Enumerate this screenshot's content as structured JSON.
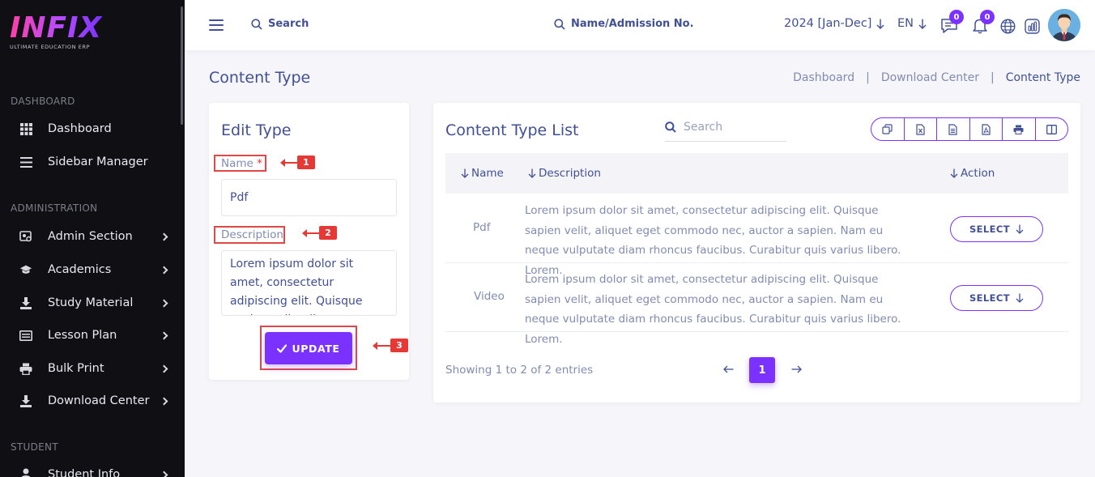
{
  "sidebar": {
    "logo": {
      "text": "INFIX",
      "subtitle": "ULTIMATE EDUCATION ERP"
    },
    "sections": [
      {
        "label": "DASHBOARD"
      },
      {
        "label": "ADMINISTRATION"
      },
      {
        "label": "STUDENT"
      }
    ],
    "items": [
      {
        "label": "Dashboard",
        "icon": "grid-icon"
      },
      {
        "label": "Sidebar Manager",
        "icon": "menu-lines-icon"
      },
      {
        "label": "Admin Section",
        "icon": "admin-icon"
      },
      {
        "label": "Academics",
        "icon": "graduation-cap-icon"
      },
      {
        "label": "Study Material",
        "icon": "download-tray-icon"
      },
      {
        "label": "Lesson Plan",
        "icon": "list-board-icon"
      },
      {
        "label": "Bulk Print",
        "icon": "printer-icon"
      },
      {
        "label": "Download Center",
        "icon": "download-tray-icon"
      },
      {
        "label": "Student Info",
        "icon": "user-icon"
      }
    ]
  },
  "header": {
    "search_label": "Search",
    "student_search_label": "Name/Admission No.",
    "academic_year": "2024 [Jan-Dec]",
    "language": "EN",
    "messages_count": "0",
    "notifications_count": "0",
    "accent": "#7c32ff"
  },
  "page": {
    "title": "Content Type",
    "breadcrumb": [
      "Dashboard",
      "Download Center",
      "Content Type"
    ]
  },
  "edit_form": {
    "title": "Edit Type",
    "name_label": "Name",
    "required_mark": "*",
    "name_value": "Pdf",
    "description_label": "Description",
    "description_value": "Lorem ipsum dolor sit amet, consectetur adipiscing elit. Quisque sapien velit, aliquet",
    "update_label": "UPDATE",
    "annotations": [
      "1",
      "2",
      "3"
    ]
  },
  "list": {
    "title": "Content Type List",
    "search_placeholder": "Search",
    "export_icons": [
      "copy-icon",
      "excel-icon",
      "csv-icon",
      "pdf-icon",
      "print-icon",
      "columns-icon"
    ],
    "columns": [
      "Name",
      "Description",
      "Action"
    ],
    "rows": [
      {
        "name": "Pdf",
        "description": "Lorem ipsum dolor sit amet, consectetur adipiscing elit. Quisque sapien velit, aliquet eget commodo nec, auctor a sapien. Nam eu neque vulputate diam rhoncus faucibus. Curabitur quis varius libero. Lorem.",
        "action": "SELECT"
      },
      {
        "name": "Video",
        "description": "Lorem ipsum dolor sit amet, consectetur adipiscing elit. Quisque sapien velit, aliquet eget commodo nec, auctor a sapien. Nam eu neque vulputate diam rhoncus faucibus. Curabitur quis varius libero. Lorem.",
        "action": "SELECT"
      }
    ],
    "showing_text": "Showing 1 to 2 of 2 entries",
    "current_page": "1"
  }
}
